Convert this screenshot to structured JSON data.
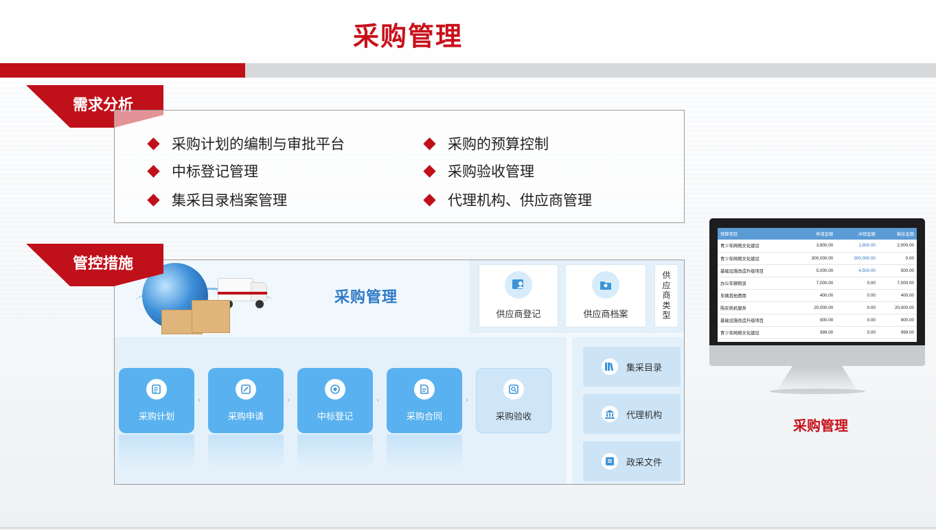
{
  "page": {
    "title": "采购管理",
    "colors": {
      "brand_red": "#c0101a",
      "accent_blue": "#59b2ef",
      "heading_blue": "#2f79c7"
    }
  },
  "demand": {
    "tag": "需求分析",
    "items": [
      "采购计划的编制与审批平台",
      "采购的预算控制",
      "中标登记管理",
      "采购验收管理",
      "集采目录档案管理",
      "代理机构、供应商管理"
    ]
  },
  "control": {
    "tag": "管控措施",
    "hero_title": "采购管理",
    "supplier_cards": [
      {
        "label": "供应商登记",
        "icon": "supplier-register-icon"
      },
      {
        "label": "供应商档案",
        "icon": "supplier-archive-icon"
      }
    ],
    "supplier_type_chars": [
      "供",
      "应",
      "商",
      "类",
      "型"
    ],
    "flow": [
      {
        "label": "采购计划",
        "icon": "plan-icon"
      },
      {
        "label": "采购申请",
        "icon": "apply-icon"
      },
      {
        "label": "中标登记",
        "icon": "bid-icon"
      },
      {
        "label": "采购合同",
        "icon": "contract-icon"
      },
      {
        "label": "采购验收",
        "icon": "acceptance-icon"
      }
    ],
    "flow_arrow": "›",
    "side_buttons": [
      {
        "label": "集采目录",
        "icon": "catalog-icon"
      },
      {
        "label": "代理机构",
        "icon": "agency-icon"
      },
      {
        "label": "政采文件",
        "icon": "document-icon"
      }
    ]
  },
  "monitor": {
    "label": "采购管理",
    "table": {
      "headers": [
        "预算项目",
        "申请金额",
        "冲销金额",
        "剩余金额"
      ],
      "rows": [
        [
          "青少年网络文化建设",
          "3,800.00",
          "1,800.00",
          "2,000.00"
        ],
        [
          "青少年网络文化建设",
          "300,000.00",
          "300,000.00",
          "0.00"
        ],
        [
          "基础设施改造升级项目",
          "5,000.00",
          "4,500.00",
          "500.00"
        ],
        [
          "办公车辆租赁",
          "7,000.00",
          "0.00",
          "7,000.00"
        ],
        [
          "车辆其他费用",
          "400.00",
          "0.00",
          "400.00"
        ],
        [
          "购买商机服务",
          "20,000.00",
          "0.00",
          "20,000.00"
        ],
        [
          "基础设施改造升级项目",
          "900.00",
          "0.00",
          "900.00"
        ],
        [
          "青少年网络文化建设",
          "999.00",
          "0.00",
          "999.00"
        ]
      ]
    }
  }
}
